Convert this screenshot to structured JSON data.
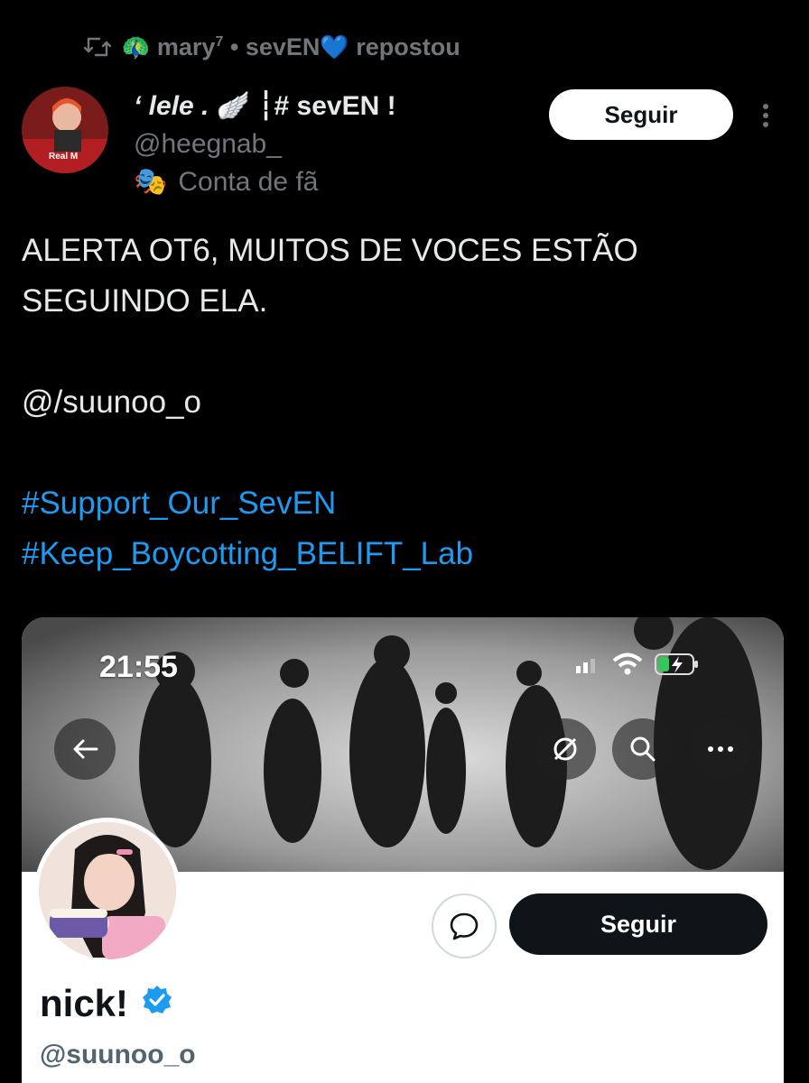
{
  "repost": {
    "user_name": "mary",
    "superscript": "7",
    "separator": "•",
    "group": "sevEN",
    "heart_emoji": "💙",
    "action": "repostou",
    "peacock_emoji": "🦚"
  },
  "author": {
    "display_name_part1": "‘ lele .",
    "wing_emoji": "🪽",
    "display_name_part2": "┆# sevEN !",
    "handle": "@heegnab_",
    "fan_label": "Conta de fã",
    "mask_emoji": "🎭",
    "follow_label": "Seguir"
  },
  "tweet": {
    "line1": "ALERTA OT6, MUITOS DE VOCES ESTÃO",
    "line2": "SEGUINDO ELA.",
    "mention": "@/suunoo_o",
    "hashtag1": "#Support_Our_SevEN",
    "hashtag2": "#Keep_Boycotting_BELIFT_Lab"
  },
  "screenshot": {
    "time": "21:55",
    "follow_label": "Seguir",
    "profile_name": "nick!",
    "profile_handle": "@suunoo_o"
  },
  "colors": {
    "background": "#000000",
    "link_blue": "#1d9bf0",
    "muted_gray": "#71767b"
  }
}
